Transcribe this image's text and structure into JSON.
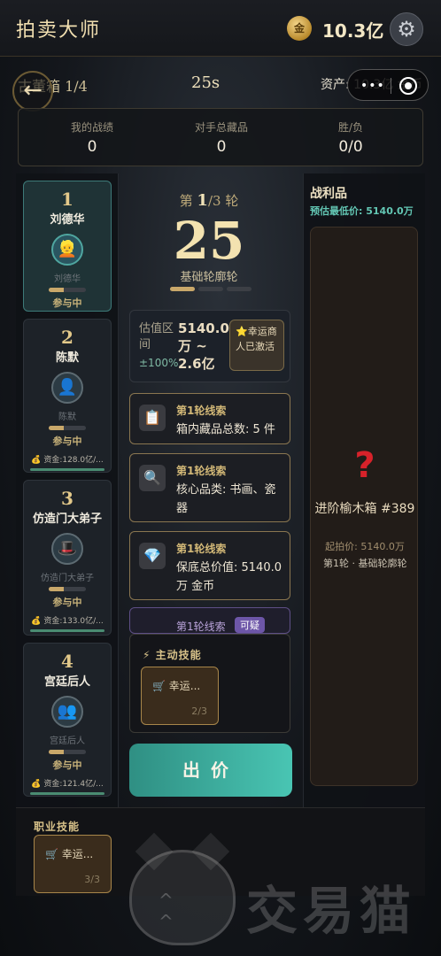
{
  "topbar": {
    "title": "拍卖大师",
    "coin_glyph": "金",
    "balance": "10.3亿"
  },
  "header": {
    "box_counter": "古董箱 1/4",
    "timer": "25s",
    "assets": "资产: 10.3亿 金币",
    "capsule_dots": "•••"
  },
  "stats": [
    {
      "label": "我的战绩",
      "value": "0"
    },
    {
      "label": "对手总藏品",
      "value": "0"
    },
    {
      "label": "胜/负",
      "value": "0/0"
    }
  ],
  "players": [
    {
      "rank": "1",
      "name": "刘德华",
      "sub": "刘德华",
      "status": "参与中",
      "progress": 0.4,
      "fund": "",
      "active": true,
      "avatar": "👱"
    },
    {
      "rank": "2",
      "name": "陈默",
      "sub": "陈默",
      "status": "参与中",
      "progress": 0.4,
      "fund": "💰 资金:128.0亿/...",
      "active": false,
      "avatar": "👤"
    },
    {
      "rank": "3",
      "name": "仿造门大弟子",
      "sub": "仿造门大弟子",
      "status": "参与中",
      "progress": 0.4,
      "fund": "💰 资金:133.0亿/...",
      "active": false,
      "avatar": "🎩"
    },
    {
      "rank": "4",
      "name": "宫廷后人",
      "sub": "宫廷后人",
      "status": "参与中",
      "progress": 0.4,
      "fund": "💰 资金:121.4亿/...",
      "active": false,
      "avatar": "👥"
    }
  ],
  "round": {
    "prefix": "第",
    "current": "1",
    "total": "/3",
    "suffix": "轮",
    "countdown": "25",
    "name": "基础轮廓轮",
    "step": 1,
    "steps": 3
  },
  "estimate": {
    "label": "估值区间",
    "pm": "±100%",
    "value": "5140.0万 ~ 2.6亿",
    "lucky": "⭐幸运商人已激活"
  },
  "clues": [
    {
      "icon": "📋",
      "title": "第1轮线索",
      "text": "箱内藏品总数: 5 件"
    },
    {
      "icon": "🔍",
      "title": "第1轮线索",
      "text": "核心品类: 书画、瓷器"
    },
    {
      "icon": "💎",
      "title": "第1轮线索",
      "text": "保底总价值: 5140.0万 金币"
    }
  ],
  "clue_partial": {
    "title": "第1轮线索",
    "tag": "可疑"
  },
  "active_skills": {
    "title": "⚡ 主动技能",
    "card_name": "🛒 幸运...",
    "card_count": "2/3"
  },
  "bid_label": "出价",
  "spoils": {
    "title": "战利品",
    "min_price": "预估最低价: 5140.0万",
    "item_mark": "?",
    "item_name": "进阶榆木箱 #389",
    "start_price": "起拍价: 5140.0万",
    "round_info": "第1轮 · 基础轮廓轮"
  },
  "career": {
    "title": "职业技能",
    "card_name": "🛒 幸运...",
    "card_count": "3/3"
  },
  "watermark": {
    "face": "^ ^",
    "text": "交易猫"
  }
}
